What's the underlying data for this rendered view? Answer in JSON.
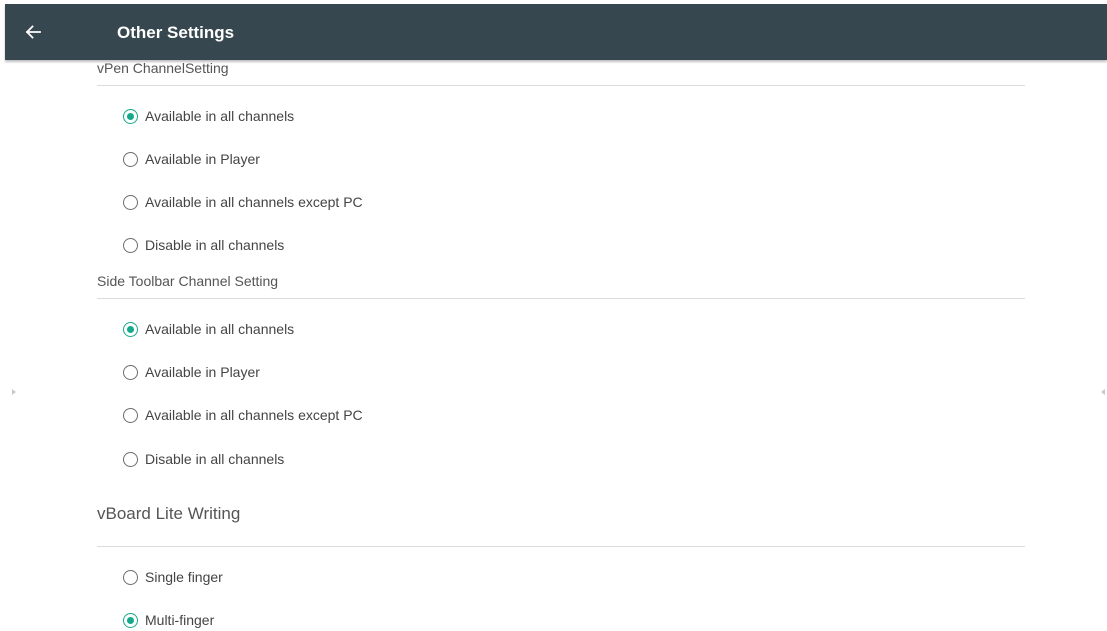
{
  "appbar": {
    "title": "Other Settings",
    "back_icon": "arrow-left-icon",
    "color": "#37474f"
  },
  "accent_color": "#14a98b",
  "sections": [
    {
      "title": "vPen ChannelSetting",
      "options": [
        {
          "label": "Available in all channels",
          "checked": true
        },
        {
          "label": "Available in Player",
          "checked": false
        },
        {
          "label": "Available in all channels except PC",
          "checked": false
        },
        {
          "label": "Disable in all channels",
          "checked": false
        }
      ]
    },
    {
      "title": "Side Toolbar Channel Setting",
      "options": [
        {
          "label": "Available in all channels",
          "checked": true
        },
        {
          "label": "Available in Player",
          "checked": false
        },
        {
          "label": "Available in all channels except PC",
          "checked": false
        },
        {
          "label": "Disable in all channels",
          "checked": false
        }
      ]
    },
    {
      "title": "vBoard Lite Writing",
      "options": [
        {
          "label": "Single finger",
          "checked": false
        },
        {
          "label": "Multi-finger",
          "checked": true
        }
      ]
    }
  ]
}
